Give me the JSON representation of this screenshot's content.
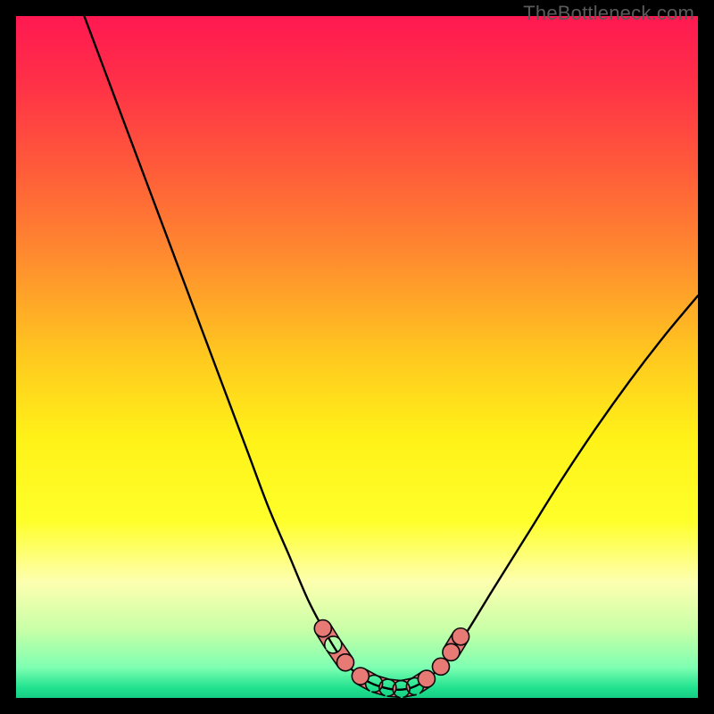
{
  "watermark": "TheBottleneck.com",
  "colors": {
    "frame": "#000000",
    "curve": "#000000",
    "marker_fill": "#e77a75",
    "marker_stroke": "#0b0b0b",
    "watermark": "#5a5a5a",
    "gradient_stops": [
      {
        "offset": 0.0,
        "color": "#ff1851"
      },
      {
        "offset": 0.1,
        "color": "#ff3147"
      },
      {
        "offset": 0.22,
        "color": "#ff5a3a"
      },
      {
        "offset": 0.35,
        "color": "#ff8a2f"
      },
      {
        "offset": 0.5,
        "color": "#ffc91f"
      },
      {
        "offset": 0.62,
        "color": "#fff218"
      },
      {
        "offset": 0.74,
        "color": "#ffff2a"
      },
      {
        "offset": 0.83,
        "color": "#fdffb0"
      },
      {
        "offset": 0.9,
        "color": "#c8ffa7"
      },
      {
        "offset": 0.955,
        "color": "#7fffb2"
      },
      {
        "offset": 0.985,
        "color": "#21e28f"
      },
      {
        "offset": 1.0,
        "color": "#15cf84"
      }
    ]
  },
  "chart_data": {
    "type": "line",
    "title": "",
    "xlabel": "",
    "ylabel": "",
    "xlim": [
      0,
      100
    ],
    "ylim": [
      0,
      100
    ],
    "series": [
      {
        "name": "curve",
        "x": [
          10,
          13,
          16,
          19,
          22,
          25,
          28,
          31,
          34,
          37,
          40,
          43,
          46,
          48,
          50,
          52,
          54,
          56,
          58,
          60,
          63,
          66,
          70,
          75,
          80,
          85,
          90,
          95,
          100
        ],
        "y": [
          100,
          92,
          84,
          76,
          68,
          60,
          52,
          44,
          36,
          28,
          21,
          14,
          8.5,
          5.5,
          3.5,
          2.2,
          1.5,
          1.2,
          1.5,
          2.6,
          5.2,
          9.5,
          16,
          24,
          32,
          39.5,
          46.5,
          53,
          59
        ]
      }
    ],
    "markers": {
      "name": "highlight-segments",
      "points": [
        {
          "x": 45.0,
          "y": 10.2
        },
        {
          "x": 46.5,
          "y": 7.8
        },
        {
          "x": 48.3,
          "y": 5.2
        },
        {
          "x": 50.5,
          "y": 3.2
        },
        {
          "x": 52.5,
          "y": 2.1
        },
        {
          "x": 54.5,
          "y": 1.5
        },
        {
          "x": 56.5,
          "y": 1.3
        },
        {
          "x": 58.5,
          "y": 1.7
        },
        {
          "x": 60.2,
          "y": 2.8
        },
        {
          "x": 62.3,
          "y": 4.6
        },
        {
          "x": 63.8,
          "y": 6.7
        },
        {
          "x": 65.2,
          "y": 9.0
        }
      ]
    }
  }
}
